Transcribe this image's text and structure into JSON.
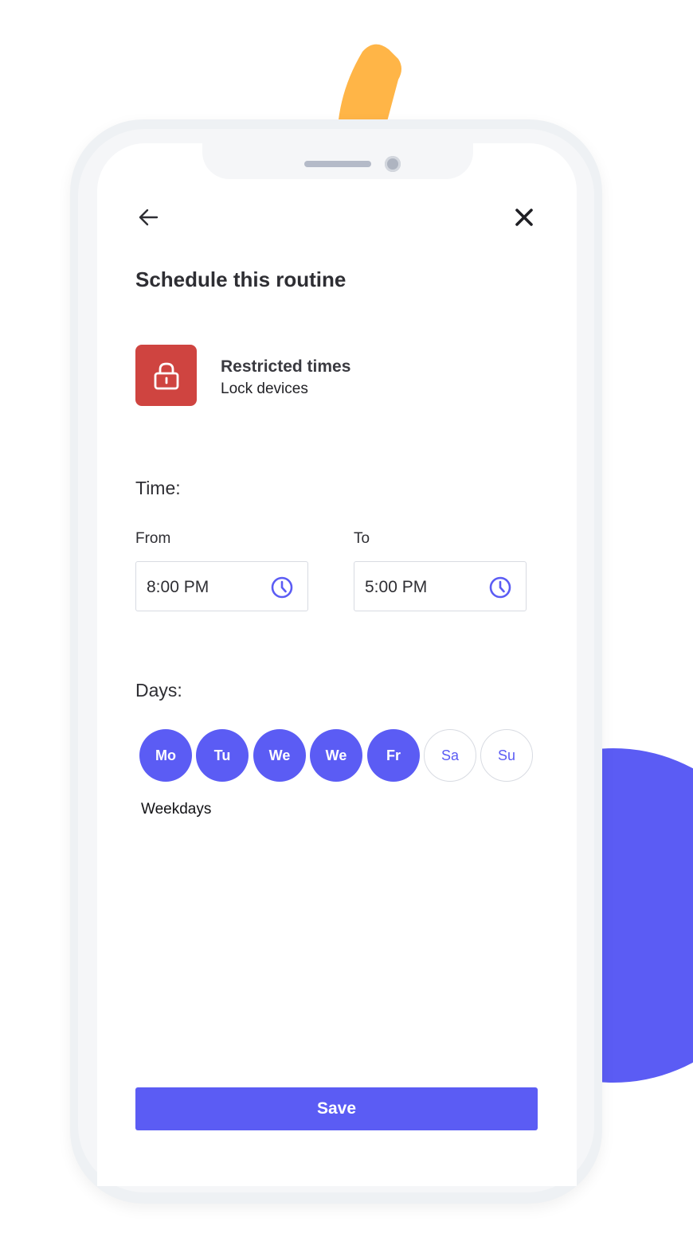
{
  "header": {
    "back_icon": "arrow-left-icon",
    "close_icon": "close-icon"
  },
  "page": {
    "title": "Schedule this routine"
  },
  "routine": {
    "icon": "lock-icon",
    "icon_color": "#cf4440",
    "name": "Restricted times",
    "description": "Lock devices"
  },
  "time": {
    "section_label": "Time:",
    "from": {
      "label": "From",
      "value": "8:00 PM",
      "icon": "clock-icon"
    },
    "to": {
      "label": "To",
      "value": "5:00 PM",
      "icon": "clock-icon"
    }
  },
  "days": {
    "section_label": "Days:",
    "items": [
      {
        "label": "Mo",
        "selected": true
      },
      {
        "label": "Tu",
        "selected": true
      },
      {
        "label": "We",
        "selected": true
      },
      {
        "label": "We",
        "selected": true
      },
      {
        "label": "Fr",
        "selected": true
      },
      {
        "label": "Sa",
        "selected": false
      },
      {
        "label": "Su",
        "selected": false
      }
    ],
    "summary": "Weekdays"
  },
  "actions": {
    "save_label": "Save"
  },
  "colors": {
    "accent": "#5b5cf4",
    "danger": "#cf4440",
    "decor_orange": "#ffb547"
  }
}
